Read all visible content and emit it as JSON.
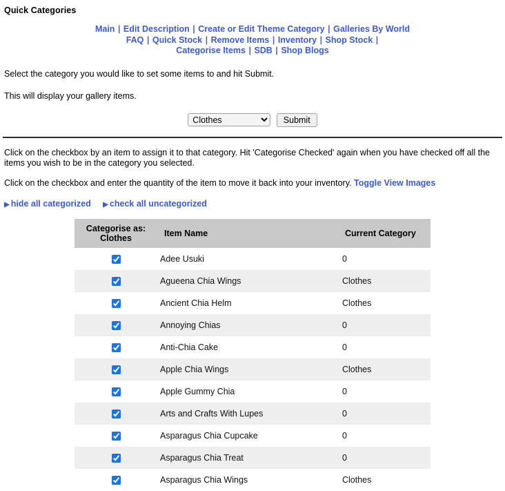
{
  "page": {
    "title": "Quick Categories"
  },
  "nav": {
    "separator": "|",
    "lines": [
      [
        "Main",
        "Edit Description",
        "Create or Edit Theme Category",
        "Galleries By World"
      ],
      [
        "FAQ",
        "Quick Stock",
        "Remove Items",
        "Inventory",
        "Shop Stock",
        ""
      ],
      [
        "Categorise Items",
        "SDB",
        "Shop Blogs"
      ]
    ]
  },
  "intro": {
    "line1": "Select the category you would like to set some items to and hit Submit.",
    "line2": "This will display your gallery items."
  },
  "form": {
    "selected_category": "Clothes",
    "category_options": [
      "Clothes"
    ],
    "submit_label": "Submit"
  },
  "instructions": {
    "line1": "Click on the checkbox by an item to assign it to that category. Hit 'Categorise Checked' again when you have checked off all the items you wish to be in the category you selected.",
    "line2": "Click on the checkbox and enter the quantity of the item to move it back into your inventory.",
    "toggle_images_link": "Toggle View Images"
  },
  "toggles": {
    "bullet": "▶",
    "hide_all": "hide all categorized",
    "check_all": "check all uncategorized"
  },
  "table": {
    "headers": {
      "checkbox_line1": "Categorise as:",
      "checkbox_line2": "Clothes",
      "item_name": "Item Name",
      "current_category": "Current Category"
    },
    "rows": [
      {
        "checked": true,
        "name": "Adee Usuki",
        "category": "0"
      },
      {
        "checked": true,
        "name": "Agueena Chia Wings",
        "category": "Clothes"
      },
      {
        "checked": true,
        "name": "Ancient Chia Helm",
        "category": "Clothes"
      },
      {
        "checked": true,
        "name": "Annoying Chias",
        "category": "0"
      },
      {
        "checked": true,
        "name": "Anti-Chia Cake",
        "category": "0"
      },
      {
        "checked": true,
        "name": "Apple Chia Wings",
        "category": "Clothes"
      },
      {
        "checked": true,
        "name": "Apple Gummy Chia",
        "category": "0"
      },
      {
        "checked": true,
        "name": "Arts and Crafts With Lupes",
        "category": "0"
      },
      {
        "checked": true,
        "name": "Asparagus Chia Cupcake",
        "category": "0"
      },
      {
        "checked": true,
        "name": "Asparagus Chia Treat",
        "category": "0"
      },
      {
        "checked": true,
        "name": "Asparagus Chia Wings",
        "category": "Clothes"
      }
    ]
  },
  "colors": {
    "link": "#3a5ad9",
    "header_bg": "#c8c8c8",
    "row_alt_bg": "#eeeeee",
    "checkbox_accent": "#1a73e8",
    "divider": "#2b2b2b"
  }
}
